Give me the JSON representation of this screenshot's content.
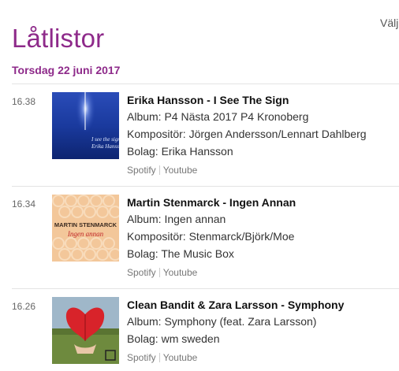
{
  "page": {
    "title": "Låtlistor",
    "select_label": "Välj"
  },
  "date_heading": "Torsdag 22 juni 2017",
  "entries": [
    {
      "time": "16.38",
      "title": "Erika Hansson - I See The Sign",
      "lines": [
        "Album: P4 Nästa 2017 P4 Kronoberg",
        "Kompositör: Jörgen Andersson/Lennart Dahlberg",
        "Bolag: Erika Hansson"
      ],
      "cover_text": [
        "I see the sign",
        "Erika Hansson"
      ],
      "links": [
        "Spotify",
        "Youtube"
      ]
    },
    {
      "time": "16.34",
      "title": "Martin Stenmarck - Ingen Annan",
      "lines": [
        "Album: Ingen annan",
        "Kompositör: Stenmarck/Björk/Moe",
        "Bolag: The Music Box"
      ],
      "cover_text": [
        "MARTIN STENMARCK",
        "Ingen annan"
      ],
      "links": [
        "Spotify",
        "Youtube"
      ]
    },
    {
      "time": "16.26",
      "title": "Clean Bandit & Zara Larsson - Symphony",
      "lines": [
        "Album: Symphony (feat. Zara Larsson)",
        "Bolag: wm sweden"
      ],
      "links": [
        "Spotify",
        "Youtube"
      ]
    }
  ],
  "colors": {
    "accent": "#8e2a8a",
    "divider": "#e3e3e3"
  }
}
